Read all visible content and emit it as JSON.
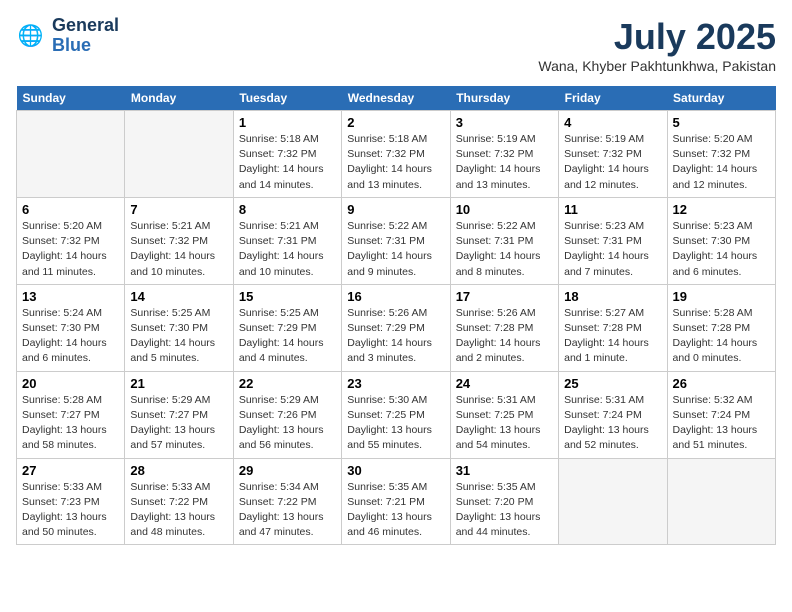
{
  "header": {
    "logo_line1": "General",
    "logo_line2": "Blue",
    "month_year": "July 2025",
    "location": "Wana, Khyber Pakhtunkhwa, Pakistan"
  },
  "weekdays": [
    "Sunday",
    "Monday",
    "Tuesday",
    "Wednesday",
    "Thursday",
    "Friday",
    "Saturday"
  ],
  "weeks": [
    [
      {
        "day": "",
        "empty": true
      },
      {
        "day": "",
        "empty": true
      },
      {
        "day": "1",
        "sunrise": "5:18 AM",
        "sunset": "7:32 PM",
        "daylight": "14 hours and 14 minutes."
      },
      {
        "day": "2",
        "sunrise": "5:18 AM",
        "sunset": "7:32 PM",
        "daylight": "14 hours and 13 minutes."
      },
      {
        "day": "3",
        "sunrise": "5:19 AM",
        "sunset": "7:32 PM",
        "daylight": "14 hours and 13 minutes."
      },
      {
        "day": "4",
        "sunrise": "5:19 AM",
        "sunset": "7:32 PM",
        "daylight": "14 hours and 12 minutes."
      },
      {
        "day": "5",
        "sunrise": "5:20 AM",
        "sunset": "7:32 PM",
        "daylight": "14 hours and 12 minutes."
      }
    ],
    [
      {
        "day": "6",
        "sunrise": "5:20 AM",
        "sunset": "7:32 PM",
        "daylight": "14 hours and 11 minutes."
      },
      {
        "day": "7",
        "sunrise": "5:21 AM",
        "sunset": "7:32 PM",
        "daylight": "14 hours and 10 minutes."
      },
      {
        "day": "8",
        "sunrise": "5:21 AM",
        "sunset": "7:31 PM",
        "daylight": "14 hours and 10 minutes."
      },
      {
        "day": "9",
        "sunrise": "5:22 AM",
        "sunset": "7:31 PM",
        "daylight": "14 hours and 9 minutes."
      },
      {
        "day": "10",
        "sunrise": "5:22 AM",
        "sunset": "7:31 PM",
        "daylight": "14 hours and 8 minutes."
      },
      {
        "day": "11",
        "sunrise": "5:23 AM",
        "sunset": "7:31 PM",
        "daylight": "14 hours and 7 minutes."
      },
      {
        "day": "12",
        "sunrise": "5:23 AM",
        "sunset": "7:30 PM",
        "daylight": "14 hours and 6 minutes."
      }
    ],
    [
      {
        "day": "13",
        "sunrise": "5:24 AM",
        "sunset": "7:30 PM",
        "daylight": "14 hours and 6 minutes."
      },
      {
        "day": "14",
        "sunrise": "5:25 AM",
        "sunset": "7:30 PM",
        "daylight": "14 hours and 5 minutes."
      },
      {
        "day": "15",
        "sunrise": "5:25 AM",
        "sunset": "7:29 PM",
        "daylight": "14 hours and 4 minutes."
      },
      {
        "day": "16",
        "sunrise": "5:26 AM",
        "sunset": "7:29 PM",
        "daylight": "14 hours and 3 minutes."
      },
      {
        "day": "17",
        "sunrise": "5:26 AM",
        "sunset": "7:28 PM",
        "daylight": "14 hours and 2 minutes."
      },
      {
        "day": "18",
        "sunrise": "5:27 AM",
        "sunset": "7:28 PM",
        "daylight": "14 hours and 1 minute."
      },
      {
        "day": "19",
        "sunrise": "5:28 AM",
        "sunset": "7:28 PM",
        "daylight": "14 hours and 0 minutes."
      }
    ],
    [
      {
        "day": "20",
        "sunrise": "5:28 AM",
        "sunset": "7:27 PM",
        "daylight": "13 hours and 58 minutes."
      },
      {
        "day": "21",
        "sunrise": "5:29 AM",
        "sunset": "7:27 PM",
        "daylight": "13 hours and 57 minutes."
      },
      {
        "day": "22",
        "sunrise": "5:29 AM",
        "sunset": "7:26 PM",
        "daylight": "13 hours and 56 minutes."
      },
      {
        "day": "23",
        "sunrise": "5:30 AM",
        "sunset": "7:25 PM",
        "daylight": "13 hours and 55 minutes."
      },
      {
        "day": "24",
        "sunrise": "5:31 AM",
        "sunset": "7:25 PM",
        "daylight": "13 hours and 54 minutes."
      },
      {
        "day": "25",
        "sunrise": "5:31 AM",
        "sunset": "7:24 PM",
        "daylight": "13 hours and 52 minutes."
      },
      {
        "day": "26",
        "sunrise": "5:32 AM",
        "sunset": "7:24 PM",
        "daylight": "13 hours and 51 minutes."
      }
    ],
    [
      {
        "day": "27",
        "sunrise": "5:33 AM",
        "sunset": "7:23 PM",
        "daylight": "13 hours and 50 minutes."
      },
      {
        "day": "28",
        "sunrise": "5:33 AM",
        "sunset": "7:22 PM",
        "daylight": "13 hours and 48 minutes."
      },
      {
        "day": "29",
        "sunrise": "5:34 AM",
        "sunset": "7:22 PM",
        "daylight": "13 hours and 47 minutes."
      },
      {
        "day": "30",
        "sunrise": "5:35 AM",
        "sunset": "7:21 PM",
        "daylight": "13 hours and 46 minutes."
      },
      {
        "day": "31",
        "sunrise": "5:35 AM",
        "sunset": "7:20 PM",
        "daylight": "13 hours and 44 minutes."
      },
      {
        "day": "",
        "empty": true
      },
      {
        "day": "",
        "empty": true
      }
    ]
  ]
}
